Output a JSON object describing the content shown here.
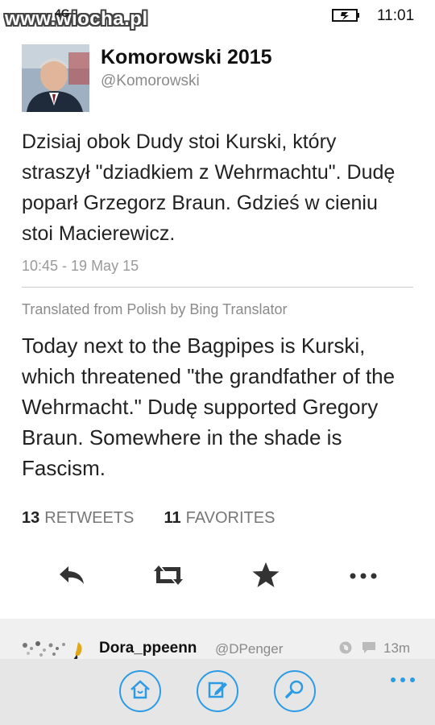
{
  "status_bar": {
    "watermark": "www.wiocha.pl",
    "signal": "4G",
    "time": "11:01"
  },
  "author": {
    "name": "Komorowski 2015",
    "handle": "@Komorowski"
  },
  "tweet": {
    "text": "Dzisiaj obok Dudy stoi Kurski,  który straszył \"dziadkiem z Wehrmachtu\". Dudę poparł Grzegorz Braun. Gdzieś w cieniu stoi Macierewicz.",
    "timestamp": "10:45 - 19 May 15",
    "translated_note": "Translated from Polish by Bing Translator",
    "translation": "Today next to the Bagpipes is Kurski, which threatened \"the grandfather of the Wehrmacht.\" Dudę supported Gregory Braun. Somewhere in the shade is Fascism."
  },
  "stats": {
    "retweets_count": "13",
    "retweets_label": "RETWEETS",
    "favorites_count": "11",
    "favorites_label": "FAVORITES"
  },
  "actions": [
    "reply-icon",
    "retweet-icon",
    "favorite-icon",
    "more-icon"
  ],
  "reply_preview": {
    "name": "Dora_ppeenn",
    "handle": "@DPenger",
    "age": "13m"
  },
  "app_bar": {
    "buttons": [
      "home-icon",
      "compose-icon",
      "search-icon"
    ],
    "accent_color": "#2c9be6"
  }
}
